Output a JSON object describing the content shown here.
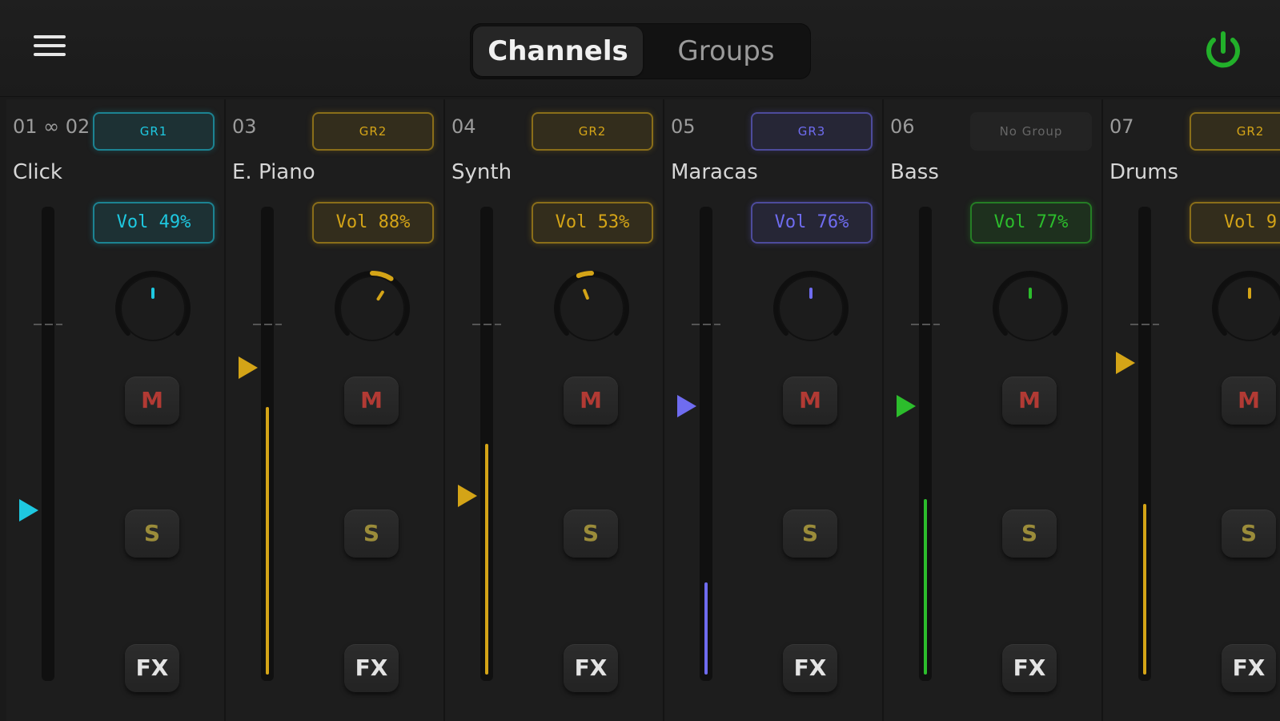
{
  "header": {
    "tabs": [
      {
        "label": "Channels",
        "active": true
      },
      {
        "label": "Groups",
        "active": false
      }
    ],
    "menu_icon": "hamburger-menu-icon",
    "power_icon": "power-icon",
    "power_color": "#22b02a"
  },
  "channels": [
    {
      "num": "01 ∞ 02",
      "name": "Click",
      "group": "GR1",
      "volume": "Vol 49%",
      "level": 0.0,
      "fader": 0.36,
      "knob": 0.5,
      "color": "#1ec8e0",
      "mute_label": "M",
      "solo_label": "S",
      "fx_label": "FX"
    },
    {
      "num": "03",
      "name": "E. Piano",
      "group": "GR2",
      "volume": "Vol 88%",
      "level": 0.58,
      "fader": 0.66,
      "knob": 0.62,
      "color": "#d4a417",
      "mute_label": "M",
      "solo_label": "S",
      "fx_label": "FX"
    },
    {
      "num": "04",
      "name": "Synth",
      "group": "GR2",
      "volume": "Vol 53%",
      "level": 0.5,
      "fader": 0.39,
      "knob": 0.42,
      "color": "#d4a417",
      "mute_label": "M",
      "solo_label": "S",
      "fx_label": "FX"
    },
    {
      "num": "05",
      "name": "Maracas",
      "group": "GR3",
      "volume": "Vol 76%",
      "level": 0.2,
      "fader": 0.58,
      "knob": 0.5,
      "color": "#6f6cf0",
      "mute_label": "M",
      "solo_label": "S",
      "fx_label": "FX"
    },
    {
      "num": "06",
      "name": "Bass",
      "group": "No Group",
      "volume": "Vol 77%",
      "level": 0.38,
      "fader": 0.58,
      "knob": 0.5,
      "color": "#2cbd2c",
      "mute_label": "M",
      "solo_label": "S",
      "fx_label": "FX"
    },
    {
      "num": "07",
      "name": "Drums",
      "group": "GR2",
      "volume": "Vol 9",
      "level": 0.37,
      "fader": 0.67,
      "knob": 0.5,
      "color": "#d4a417",
      "mute_label": "M",
      "solo_label": "S",
      "fx_label": "FX"
    }
  ]
}
